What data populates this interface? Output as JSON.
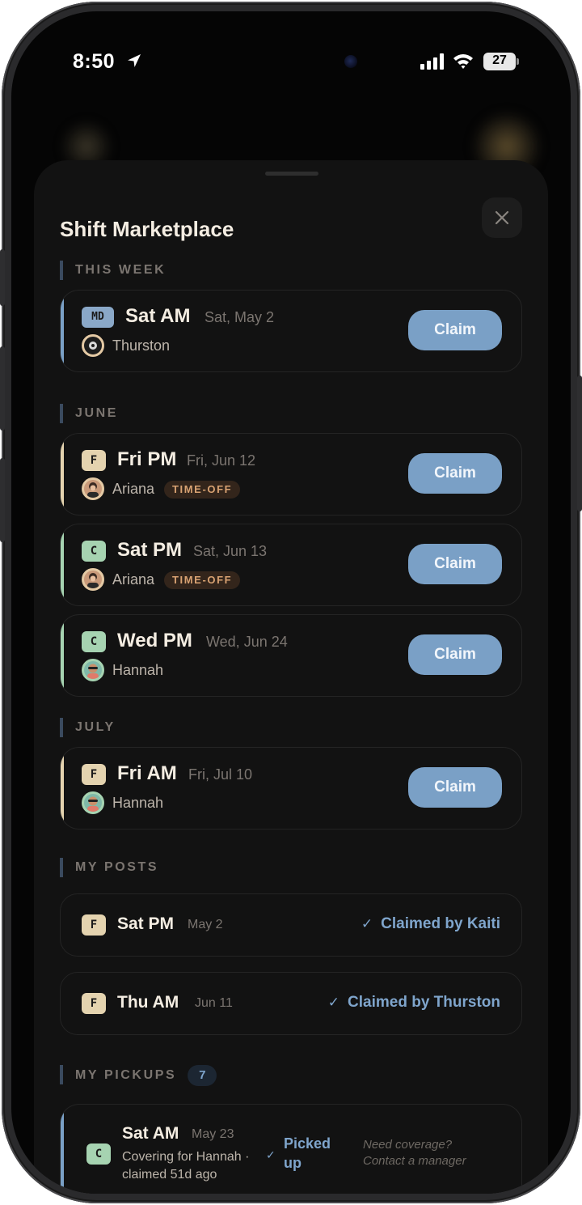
{
  "status_bar": {
    "time": "8:50",
    "battery": "27"
  },
  "sheet": {
    "title": "Shift Marketplace",
    "close_icon": "close-icon"
  },
  "sections": {
    "this_week": "THIS WEEK",
    "june": "JUNE",
    "july": "JULY",
    "my_posts": "MY POSTS",
    "my_pickups": "MY PICKUPS",
    "my_pickups_count": "7"
  },
  "colors": {
    "accent_blue": "#7aa0c6",
    "accent_tan": "#e4d3af",
    "accent_green": "#a6d3b1",
    "timeoff_text": "#d8a272"
  },
  "marketplace": [
    {
      "tag": "MD",
      "shift": "Sat AM",
      "date": "Sat, May 2",
      "person": "Thurston",
      "badge": "",
      "action": "Claim"
    },
    {
      "tag": "F",
      "shift": "Fri PM",
      "date": "Fri, Jun 12",
      "person": "Ariana",
      "badge": "TIME-OFF",
      "action": "Claim"
    },
    {
      "tag": "C",
      "shift": "Sat PM",
      "date": "Sat, Jun 13",
      "person": "Ariana",
      "badge": "TIME-OFF",
      "action": "Claim"
    },
    {
      "tag": "C",
      "shift": "Wed PM",
      "date": "Wed, Jun 24",
      "person": "Hannah",
      "badge": "",
      "action": "Claim"
    },
    {
      "tag": "F",
      "shift": "Fri AM",
      "date": "Fri, Jul 10",
      "person": "Hannah",
      "badge": "",
      "action": "Claim"
    }
  ],
  "my_posts": [
    {
      "tag": "F",
      "shift": "Sat PM",
      "date": "May 2",
      "status": "Claimed by Kaiti"
    },
    {
      "tag": "F",
      "shift": "Thu AM",
      "date": "Jun 11",
      "status": "Claimed by Thurston"
    }
  ],
  "my_pickups": [
    {
      "tag": "C",
      "shift": "Sat AM",
      "date": "May 23",
      "line1": "Covering for Hannah ·",
      "line2": "claimed 51d ago",
      "status_line1": "Picked",
      "status_line2": "up",
      "note_line1": "Need coverage?",
      "note_line2": "Contact a manager"
    }
  ]
}
